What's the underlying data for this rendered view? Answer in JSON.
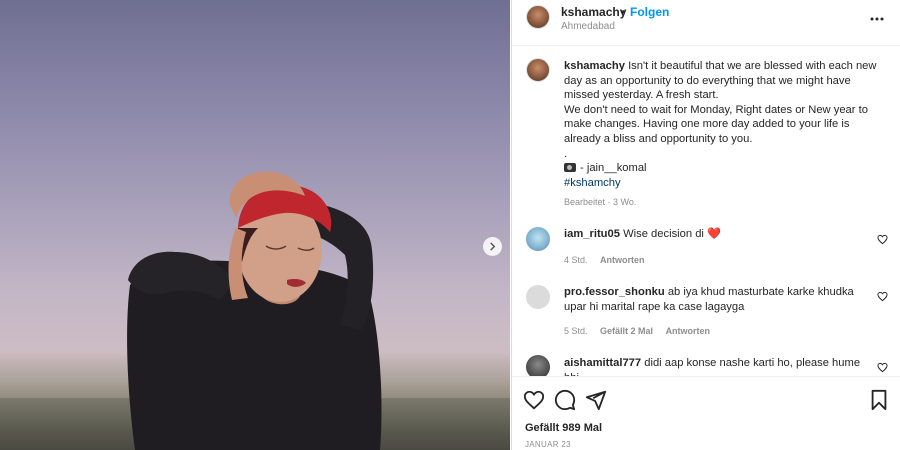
{
  "post": {
    "username": "kshamachy",
    "follow_label": "Folgen",
    "separator": "•",
    "location": "Ahmedabad",
    "caption": {
      "line1": "Isn't it beautiful that we are blessed with each new day as an opportunity to do everything that we might have missed yesterday. A fresh start.",
      "line2": "We don't need to wait for Monday, Right dates or New year to make changes. Having one more day added to your life is already a bliss and opportunity to you.",
      "dot": ".",
      "credit": "- jain__komal",
      "hashtag": "#kshamchy"
    },
    "caption_meta": "Bearbeitet · 3 Wo."
  },
  "comments": [
    {
      "username": "iam_ritu05",
      "text": "Wise decision di",
      "emoji": "❤️",
      "time": "4 Std.",
      "likes": "",
      "reply_label": "Antworten"
    },
    {
      "username": "pro.fessor_shonku",
      "text": "ab iya khud masturbate karke khudka upar hi marital rape ka case lagayga",
      "time": "5 Std.",
      "likes": "Gefällt 2 Mal",
      "reply_label": "Antworten"
    },
    {
      "username": "aishamittal777",
      "text": "didi aap konse nashe karti ho, please hume bhi",
      "time": "",
      "likes": "",
      "reply_label": ""
    }
  ],
  "footer": {
    "likes_text": "Gefällt 989 Mal",
    "date_text": "JANUAR 23"
  },
  "icons": {
    "more": "more-icon",
    "like": "heart-icon",
    "comment": "comment-icon",
    "share": "share-icon",
    "save": "bookmark-icon",
    "next": "chevron-right-icon"
  },
  "colors": {
    "follow": "#0095f6",
    "hashtag": "#00376b",
    "heart": "#ed4956"
  }
}
